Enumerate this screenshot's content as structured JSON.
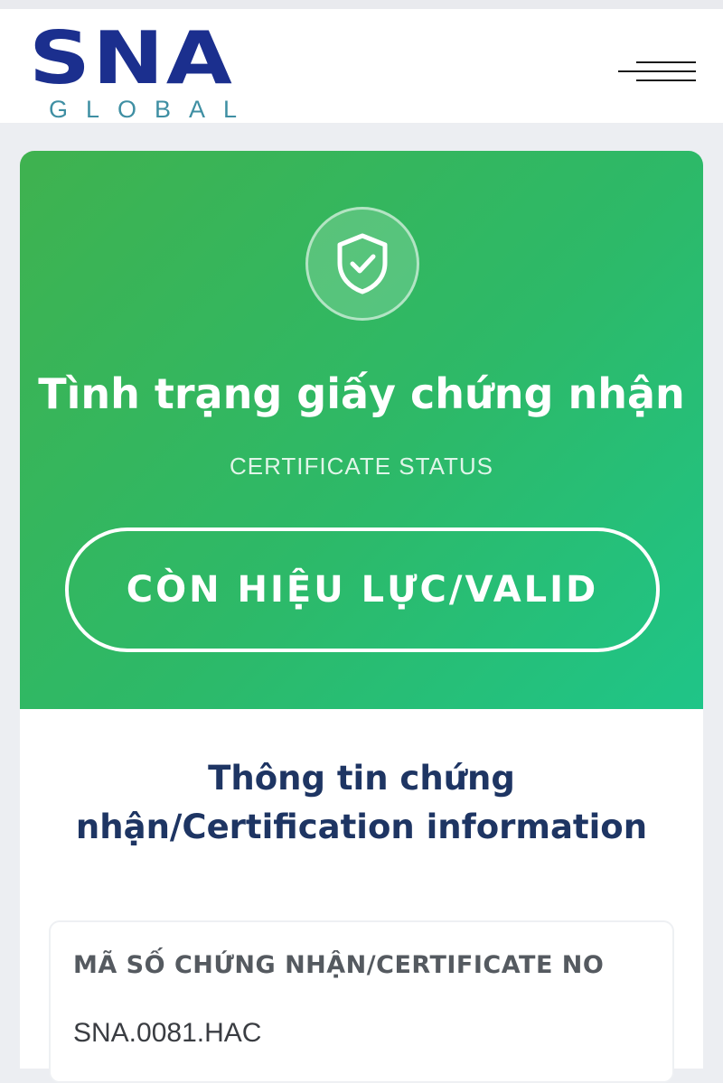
{
  "header": {
    "logo_main": "SNA",
    "logo_sub": "GLOBAL",
    "brand_color": "#1b2f8e",
    "menu_icon": "hamburger-menu-icon"
  },
  "status": {
    "icon": "shield-check-icon",
    "title": "Tình trạng giấy chứng nhận",
    "subtitle": "CERTIFICATE STATUS",
    "value": "CÒN HIỆU LỰC/VALID",
    "color": "#2db968"
  },
  "info": {
    "title": "Thông tin chứng nhận/Certification information",
    "fields": [
      {
        "label": "MÃ SỐ CHỨNG NHẬN/CERTIFICATE NO",
        "value": "SNA.0081.HAC"
      }
    ]
  }
}
